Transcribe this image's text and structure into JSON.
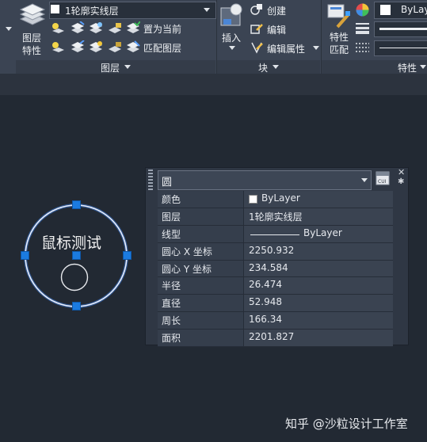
{
  "ribbon": {
    "layer_properties_label": "图层\n特性",
    "layer_dropdown_value": "1轮廓实线层",
    "set_current_label": "置为当前",
    "match_layer_label": "匹配图层",
    "layers_panel_label": "图层",
    "insert_label": "插入",
    "create_label": "创建",
    "edit_label": "编辑",
    "edit_attributes_label": "编辑属性",
    "block_panel_label": "块",
    "match_properties_label": "特性\n匹配",
    "color_value": "ByLay",
    "properties_panel_label": "特性"
  },
  "canvas": {
    "circle_text": "鼠标测试"
  },
  "palette": {
    "object_type": "圆",
    "rows": [
      {
        "key": "颜色",
        "value": "ByLayer"
      },
      {
        "key": "图层",
        "value": "1轮廓实线层"
      },
      {
        "key": "线型",
        "value": "ByLayer"
      },
      {
        "key": "圆心 X 坐标",
        "value": "2250.932"
      },
      {
        "key": "圆心 Y 坐标",
        "value": "234.584"
      },
      {
        "key": "半径",
        "value": "26.474"
      },
      {
        "key": "直径",
        "value": "52.948"
      },
      {
        "key": "周长",
        "value": "166.34"
      },
      {
        "key": "面积",
        "value": "2201.827"
      }
    ]
  },
  "watermark": "知乎 @沙粒设计工作室",
  "colors": {
    "accent": "#1b7be0",
    "canvas": "#222933",
    "ribbon": "#3b4453"
  }
}
